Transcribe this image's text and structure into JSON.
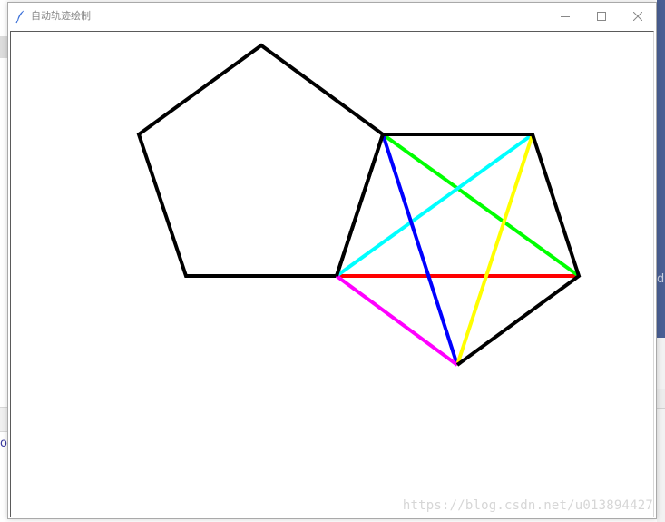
{
  "window": {
    "title": "自动轨迹绘制",
    "icon": "feather-icon",
    "controls": {
      "minimize_icon": "minimize-icon",
      "maximize_icon": "maximize-icon",
      "close_icon": "close-icon"
    }
  },
  "canvas": {
    "background": "#ffffff",
    "watermark": "https://blog.csdn.net/u013894427",
    "shapes": {
      "left_pentagon": {
        "stroke": "#000000"
      },
      "right_pentagon": {
        "stroke": "#000000"
      },
      "diagonals": [
        {
          "name": "red-diagonal",
          "color": "#ff0000"
        },
        {
          "name": "green-diagonal",
          "color": "#00ff00"
        },
        {
          "name": "cyan-diagonal",
          "color": "#00ffff"
        },
        {
          "name": "blue-diagonal",
          "color": "#0000ff"
        },
        {
          "name": "yellow-diagonal",
          "color": "#ffff00"
        },
        {
          "name": "magenta-diagonal",
          "color": "#ff00ff"
        }
      ]
    }
  },
  "background_fragments": {
    "right_glyph": "d",
    "left_glyph": "o"
  }
}
